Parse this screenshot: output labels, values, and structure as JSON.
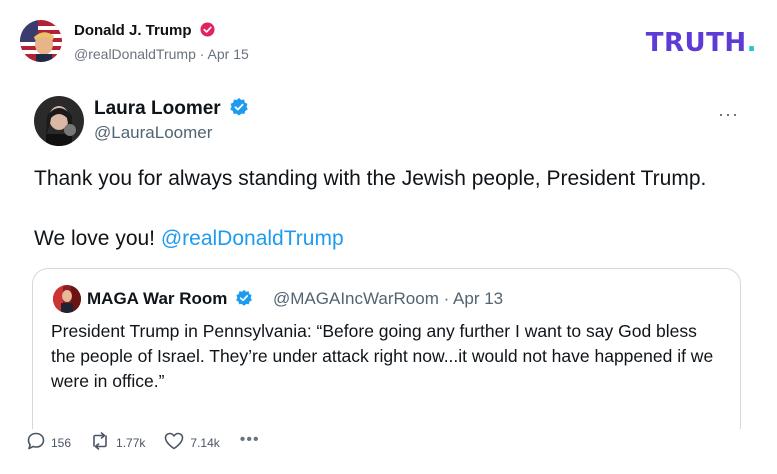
{
  "post": {
    "author_name": "Donald J. Trump",
    "author_handle": "@realDonaldTrump",
    "separator": " · ",
    "date": "Apr 15",
    "brand": "TRUTH",
    "brand_dot": ".",
    "colors": {
      "brand": "#5f3bd6",
      "brand_dot": "#23c7c7",
      "verified_badge": "#e0245e"
    }
  },
  "embedded_tweet": {
    "author_name": "Laura Loomer",
    "author_handle": "@LauraLoomer",
    "more_label": "···",
    "text_line1": "Thank you for always standing with the Jewish people, President Trump.",
    "text_line2_prefix": "We love you! ",
    "mention": "@realDonaldTrump",
    "colors": {
      "verified_badge": "#1d9bf0",
      "mention": "#1d9bf0"
    }
  },
  "quoted_tweet": {
    "author_name": "MAGA War Room",
    "author_handle": "@MAGAIncWarRoom",
    "separator": " · ",
    "date": "Apr 13",
    "text": "President Trump in Pennsylvania: “Before going any further I want to say God bless the people of Israel. They’re under attack right now...it would not have happened if we were in office.”"
  },
  "actions": {
    "replies": "156",
    "retruths": "1.77k",
    "likes": "7.14k",
    "more_label": "•••",
    "icons": [
      "reply-icon",
      "retruth-icon",
      "like-icon",
      "more-icon"
    ]
  }
}
